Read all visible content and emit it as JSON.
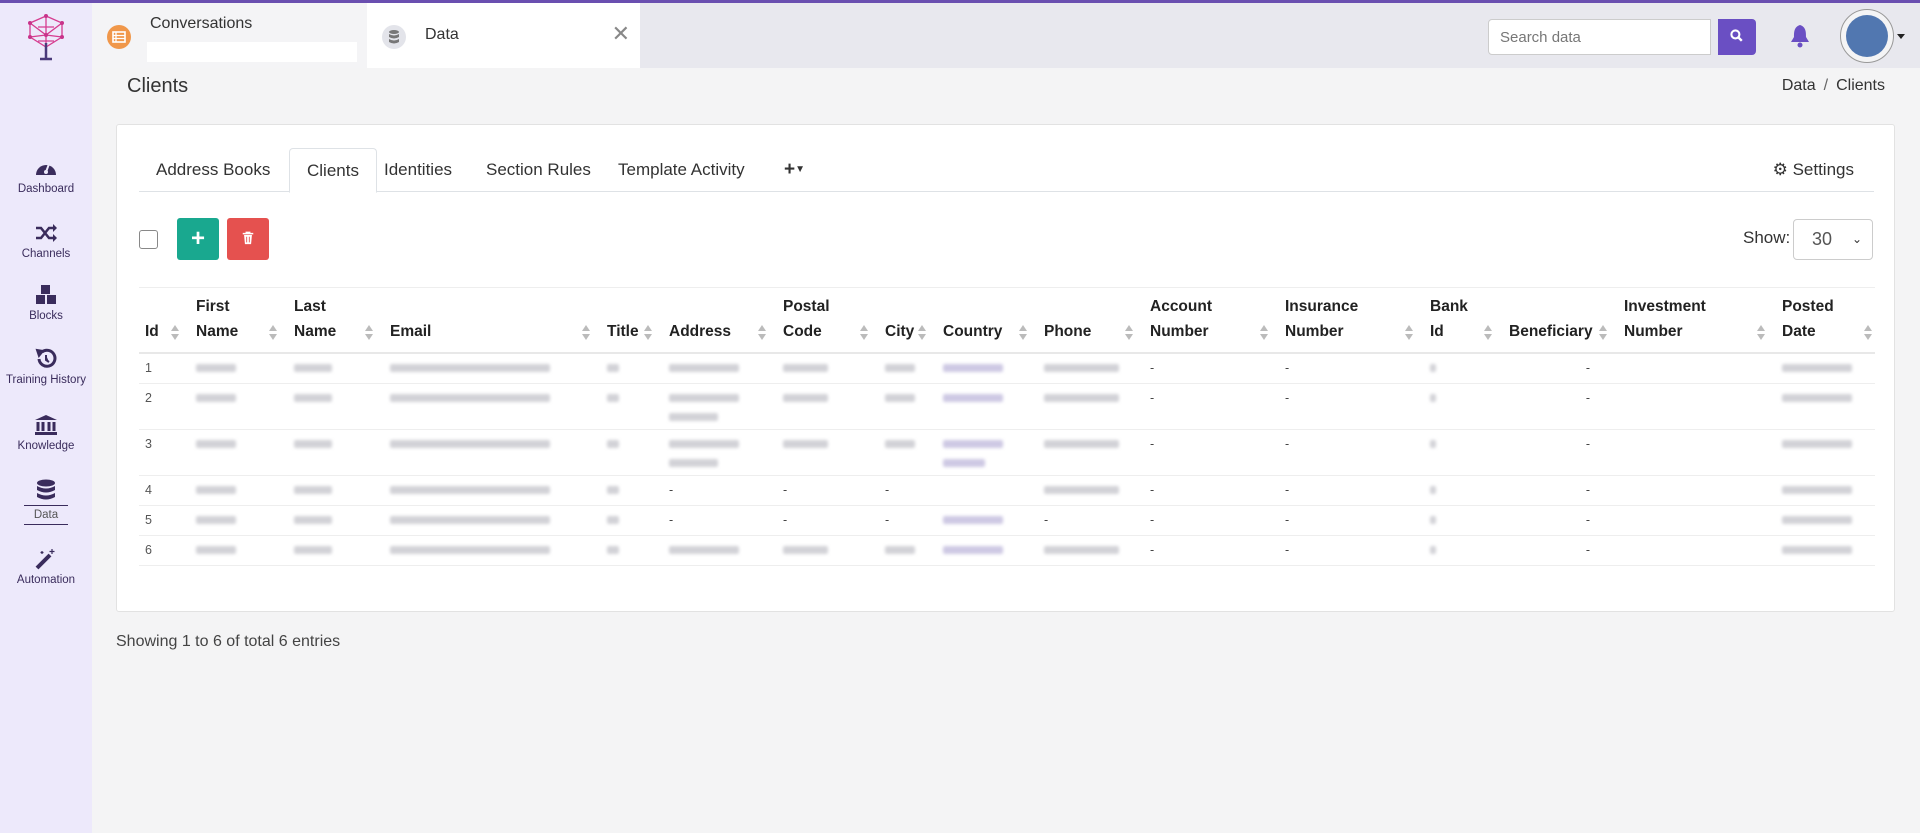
{
  "colors": {
    "accent": "#6a4fc3",
    "add": "#19a88f",
    "delete": "#e5514f",
    "conversations_icon": "#f0974a"
  },
  "sidebar": {
    "items": [
      {
        "label": "Dashboard",
        "icon": "gauge-icon"
      },
      {
        "label": "Channels",
        "icon": "shuffle-icon"
      },
      {
        "label": "Blocks",
        "icon": "cubes-icon"
      },
      {
        "label": "Training History",
        "icon": "history-icon"
      },
      {
        "label": "Knowledge",
        "icon": "bank-icon"
      },
      {
        "label": "Data",
        "icon": "database-icon",
        "active": true
      },
      {
        "label": "Automation",
        "icon": "magic-wand-icon"
      }
    ]
  },
  "topbar": {
    "tabs": [
      {
        "title": "Conversations",
        "icon": "list-icon"
      },
      {
        "title": "Data",
        "icon": "database-icon"
      }
    ],
    "search_placeholder": "Search data"
  },
  "page": {
    "title": "Clients",
    "breadcrumb": [
      "Data",
      "Clients"
    ]
  },
  "card": {
    "tabs": [
      "Address Books",
      "Clients",
      "Identities",
      "Section Rules",
      "Template Activity"
    ],
    "active_tab": "Clients",
    "settings_label": "Settings",
    "show_label": "Show:",
    "page_size": "30"
  },
  "table": {
    "columns": [
      [
        "Id"
      ],
      [
        "First",
        "Name"
      ],
      [
        "Last",
        "Name"
      ],
      [
        "Email"
      ],
      [
        "Title"
      ],
      [
        "Address"
      ],
      [
        "Postal",
        "Code"
      ],
      [
        "City"
      ],
      [
        "Country"
      ],
      [
        "Phone"
      ],
      [
        "Account",
        "Number"
      ],
      [
        "Insurance",
        "Number"
      ],
      [
        "Bank",
        "Id"
      ],
      [
        "Beneficiary"
      ],
      [
        "Investment",
        "Number"
      ],
      [
        "Posted",
        "Date"
      ]
    ],
    "rows": [
      {
        "id": "1",
        "cells": [
          null,
          null,
          null,
          null,
          null,
          null,
          null,
          null,
          null,
          "-",
          "-",
          null,
          "-",
          "",
          null
        ]
      },
      {
        "id": "2",
        "cells": [
          null,
          null,
          null,
          null,
          null,
          null,
          null,
          null,
          null,
          "-",
          "-",
          null,
          "-",
          "",
          null
        ]
      },
      {
        "id": "3",
        "cells": [
          null,
          null,
          null,
          null,
          null,
          null,
          null,
          null,
          null,
          "-",
          "-",
          null,
          "-",
          "",
          null
        ]
      },
      {
        "id": "4",
        "cells": [
          null,
          null,
          null,
          null,
          "-",
          "-",
          "-",
          "",
          null,
          "-",
          "-",
          null,
          "-",
          "",
          null
        ]
      },
      {
        "id": "5",
        "cells": [
          null,
          null,
          null,
          null,
          "-",
          "-",
          "-",
          null,
          "-",
          "-",
          "-",
          null,
          "-",
          "",
          null
        ]
      },
      {
        "id": "6",
        "cells": [
          null,
          null,
          null,
          null,
          null,
          null,
          null,
          null,
          null,
          "-",
          "-",
          null,
          "-",
          "",
          null
        ]
      }
    ]
  },
  "footer": "Showing 1 to 6 of total 6 entries"
}
